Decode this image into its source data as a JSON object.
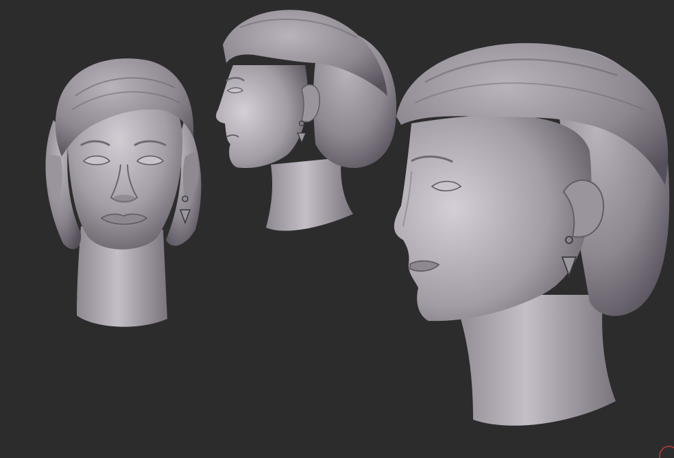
{
  "scene": {
    "background_color": "#2c2c2c",
    "clay_color": "#a49ea6",
    "clay_shadow_color": "#5e5a60",
    "clay_highlight_color": "#d6d2d8",
    "earring_color": "#3a3a3c",
    "views": [
      "front-view",
      "side-view",
      "three-quarter-view"
    ]
  },
  "corner_mark": {
    "icon": "circle-arc-icon",
    "color": "#c23a3a"
  }
}
